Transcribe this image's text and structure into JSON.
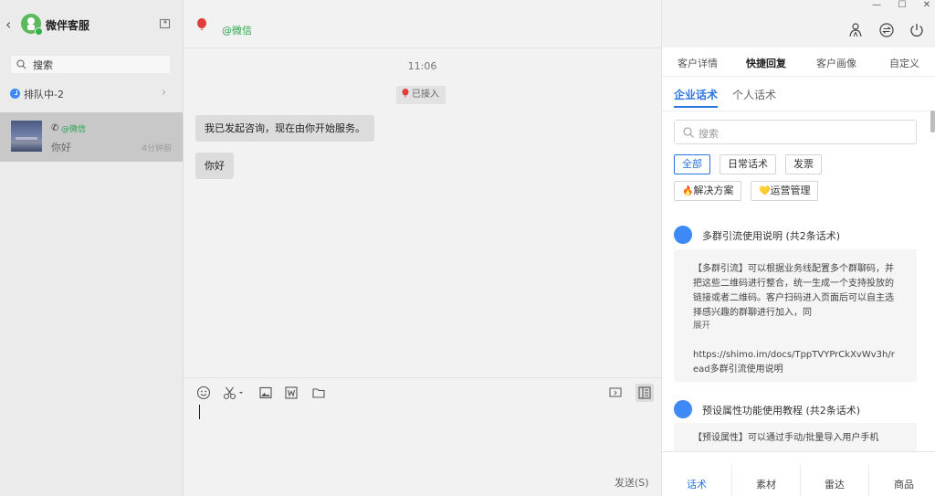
{
  "app": {
    "title": "微伴客服",
    "back_glyph": "‹"
  },
  "left": {
    "search_placeholder": "搜索",
    "queue_label": "排队中-2",
    "queue_chevron": "›",
    "conversation": {
      "phone_glyph": "✆",
      "name": "@微信",
      "last_message": "你好",
      "time": "4分钟前"
    }
  },
  "chat": {
    "contact_name": "@微信",
    "time_label": "11:06",
    "system_badge": "已接入",
    "messages": [
      "我已发起咨询，现在由你开始服务。",
      "你好"
    ],
    "send_label": "发送(S)"
  },
  "right": {
    "window_controls": [
      "—",
      "☐",
      "✕"
    ],
    "tabs": [
      "客户详情",
      "快捷回复",
      "客户画像",
      "自定义"
    ],
    "active_tab": 1,
    "sub_tabs": [
      "企业话术",
      "个人话术"
    ],
    "search_placeholder": "搜索",
    "chips_row1": [
      "全部",
      "日常话术",
      "发票"
    ],
    "chips_row2": [
      "解决方案",
      "运营管理"
    ],
    "chip_emojis": [
      "🔥",
      "💛"
    ],
    "groups": [
      {
        "title": "多群引流使用说明 (共2条话术)",
        "text": "【多群引流】可以根据业务线配置多个群聊码，并把这些二维码进行整合，统一生成一个支持投放的链接或者二维码。客户扫码进入页面后可以自主选择感兴趣的群聊进行加入，同",
        "expand": "展开",
        "url": "https://shimo.im/docs/TppTVYPrCkXvWv3h/read多群引流使用说明"
      },
      {
        "title": "预设属性功能使用教程 (共2条话术)",
        "text": "【预设属性】可以通过手动/批量导入用户手机"
      }
    ],
    "bottom_tabs": [
      "话术",
      "素材",
      "雷达",
      "商品"
    ]
  },
  "colors": {
    "accent": "#2a75e0",
    "wechat_green": "#2aa44b",
    "group_dot": "#3d8af7"
  }
}
